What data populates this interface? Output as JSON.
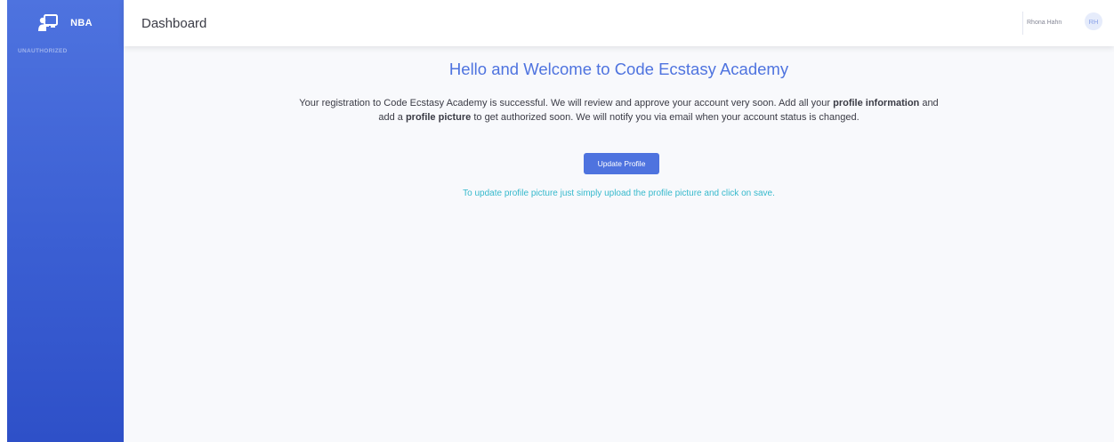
{
  "brand": {
    "name": "NBA",
    "status": "UNAUTHORIZED"
  },
  "topbar": {
    "title": "Dashboard",
    "user_name": "Rhona Hahn",
    "user_initials": "RH"
  },
  "main": {
    "heading": "Hello and Welcome to Code Ecstasy Academy",
    "message": {
      "part1": "Your registration to Code Ecstasy Academy is successful. We will review and approve your account very soon. Add all your ",
      "bold1": "profile information",
      "part2": " and add a ",
      "bold2": "profile picture",
      "part3": " to get authorized soon. We will notify you via email when your account status is changed."
    },
    "update_button": "Update Profile",
    "hint": "To update profile picture just simply upload the profile picture and click on save."
  },
  "colors": {
    "primary": "#4e73df",
    "info": "#36b9cc",
    "text": "#3a3b45"
  },
  "icons": {
    "brand": "chalkboard-teacher-icon"
  }
}
